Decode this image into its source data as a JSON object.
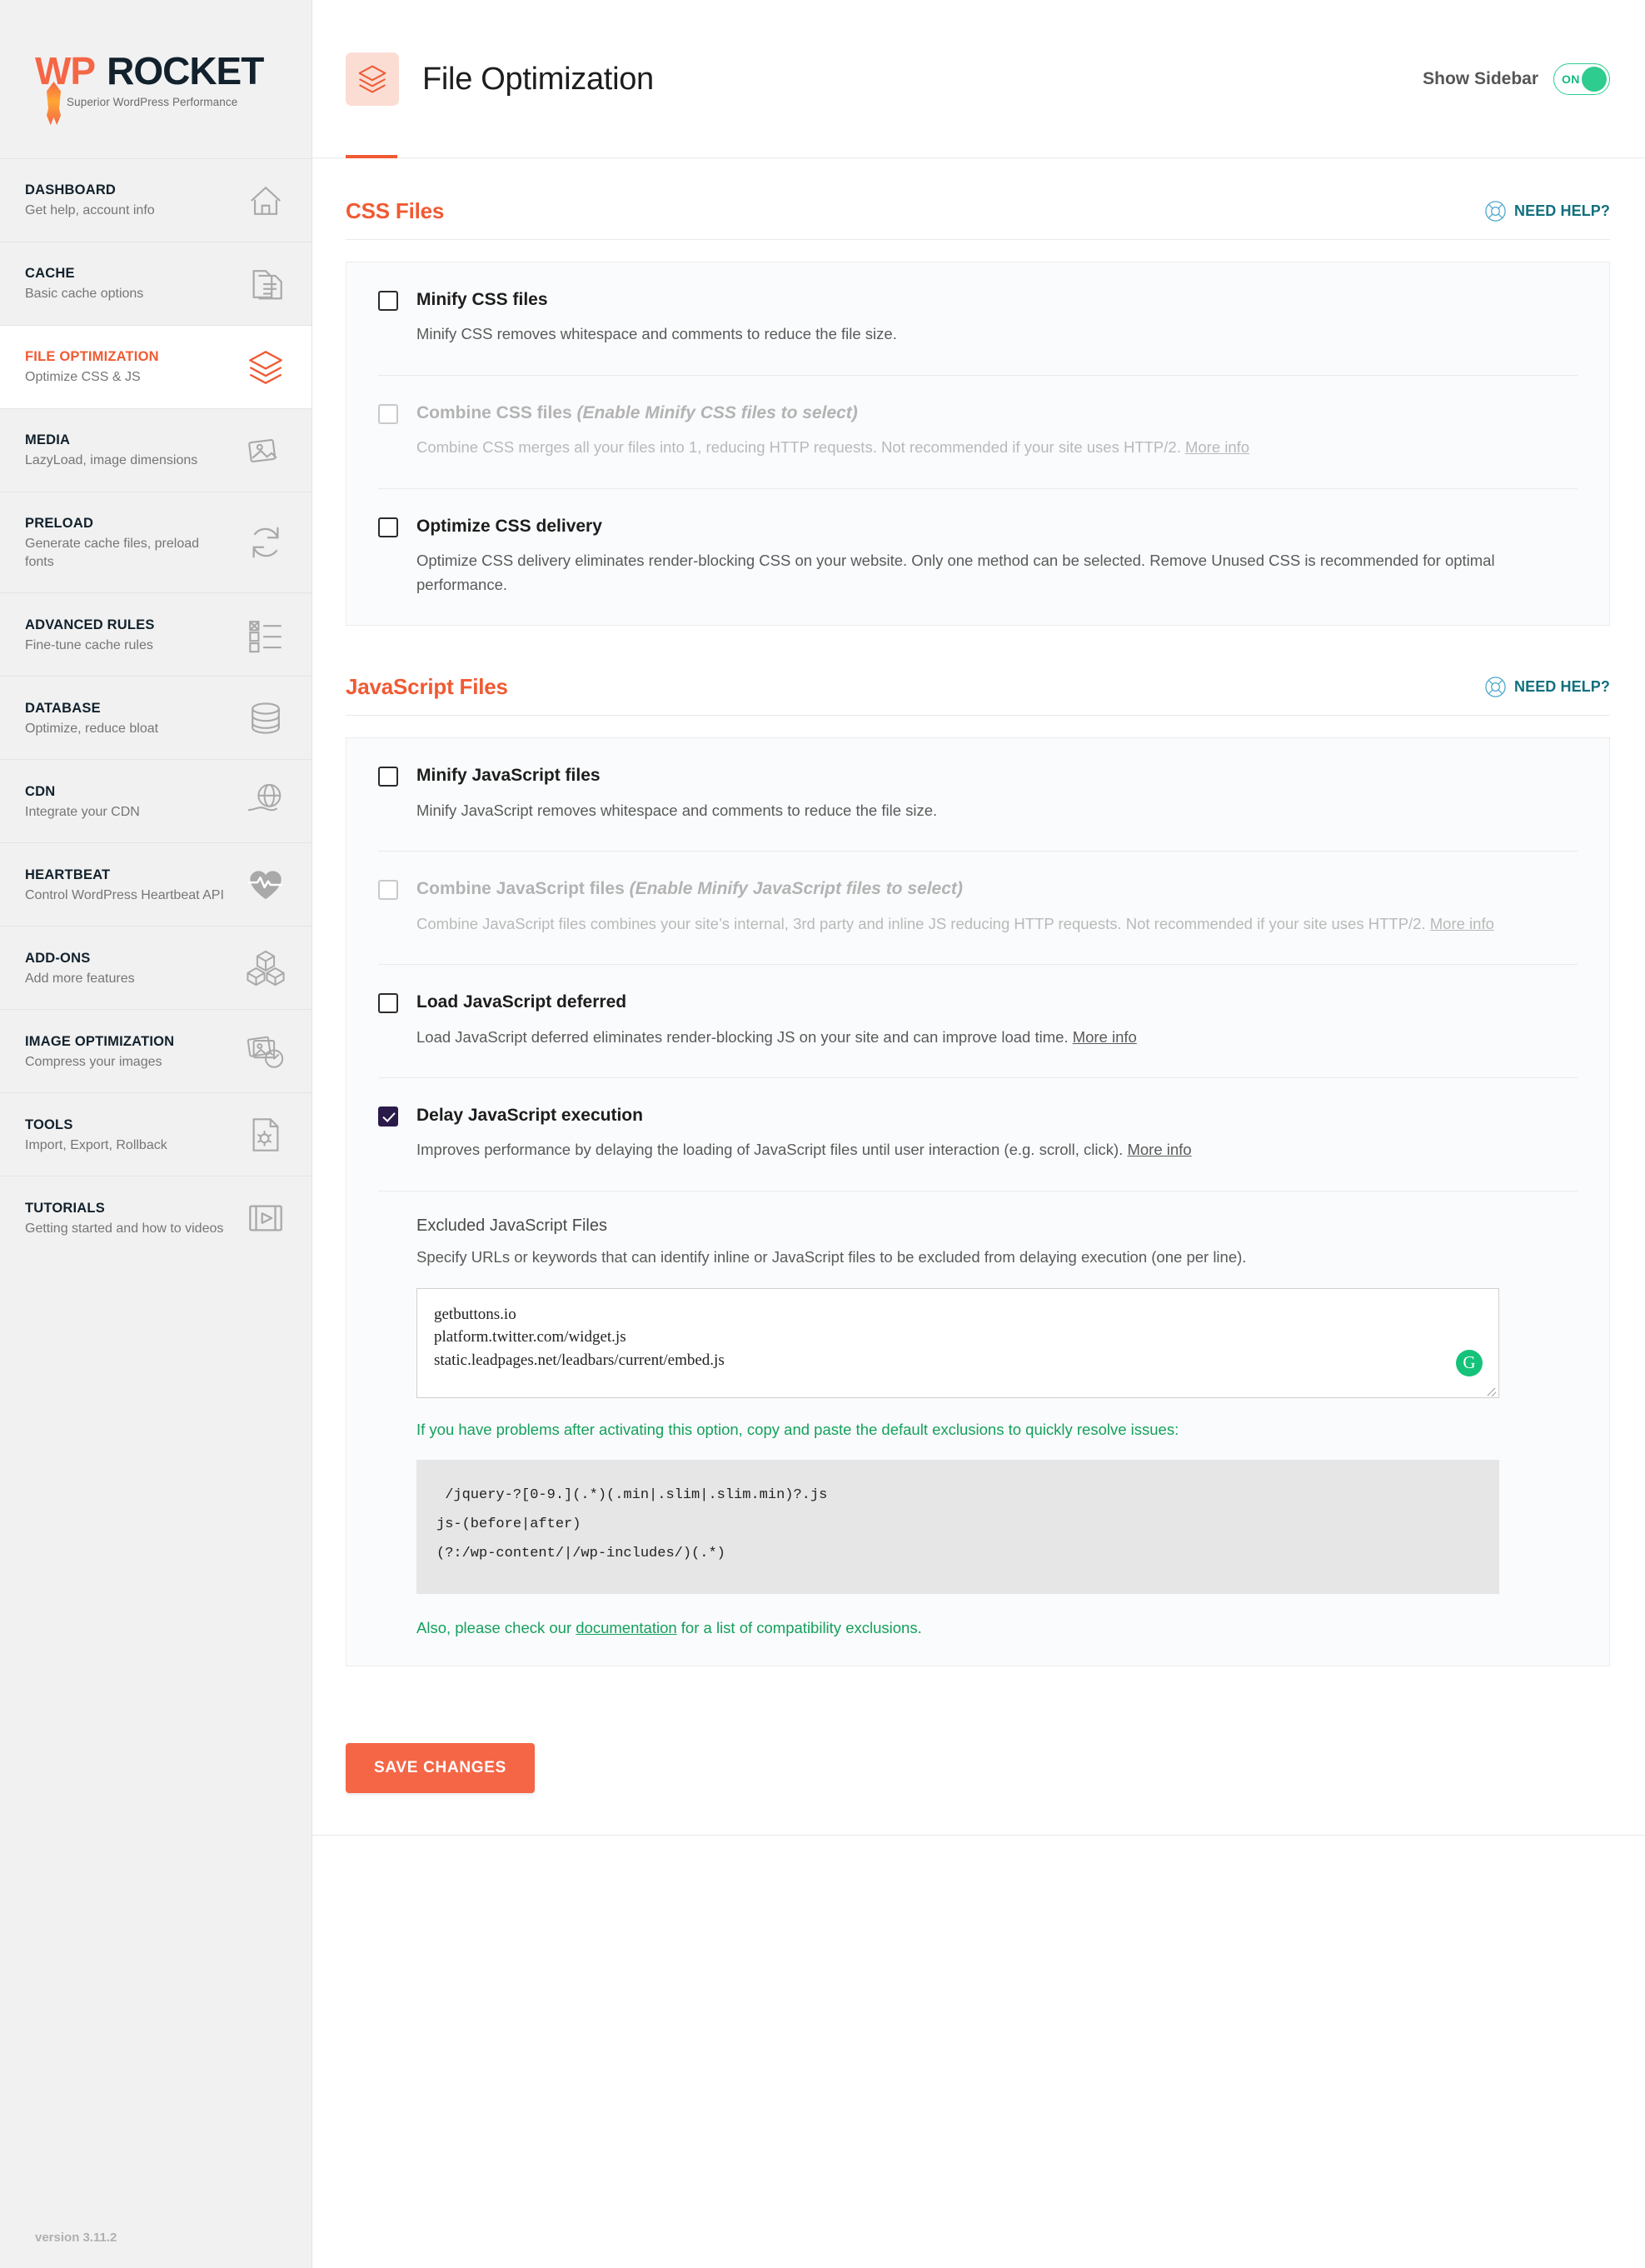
{
  "brand": {
    "wp": "WP",
    "rocket": "ROCKET",
    "tagline": "Superior WordPress Performance",
    "version": "version 3.11.2"
  },
  "sidebar": {
    "items": [
      {
        "title": "DASHBOARD",
        "desc": "Get help, account info",
        "icon": "home-icon",
        "active": false
      },
      {
        "title": "CACHE",
        "desc": "Basic cache options",
        "icon": "document-icon",
        "active": false
      },
      {
        "title": "FILE OPTIMIZATION",
        "desc": "Optimize CSS & JS",
        "icon": "layers-icon",
        "active": true
      },
      {
        "title": "MEDIA",
        "desc": "LazyLoad, image dimensions",
        "icon": "images-icon",
        "active": false
      },
      {
        "title": "PRELOAD",
        "desc": "Generate cache files, preload fonts",
        "icon": "refresh-icon",
        "active": false
      },
      {
        "title": "ADVANCED RULES",
        "desc": "Fine-tune cache rules",
        "icon": "checklist-icon",
        "active": false
      },
      {
        "title": "DATABASE",
        "desc": "Optimize, reduce bloat",
        "icon": "database-icon",
        "active": false
      },
      {
        "title": "CDN",
        "desc": "Integrate your CDN",
        "icon": "cdn-globe-icon",
        "active": false
      },
      {
        "title": "HEARTBEAT",
        "desc": "Control WordPress Heartbeat API",
        "icon": "heartbeat-icon",
        "active": false
      },
      {
        "title": "ADD-ONS",
        "desc": "Add more features",
        "icon": "blocks-icon",
        "active": false
      },
      {
        "title": "IMAGE OPTIMIZATION",
        "desc": "Compress your images",
        "icon": "image-compress-icon",
        "active": false
      },
      {
        "title": "TOOLS",
        "desc": "Import, Export, Rollback",
        "icon": "file-gear-icon",
        "active": false
      },
      {
        "title": "TUTORIALS",
        "desc": "Getting started and how to videos",
        "icon": "video-icon",
        "active": false
      }
    ]
  },
  "header": {
    "title": "File Optimization",
    "icon": "layers-icon",
    "show_sidebar_label": "Show Sidebar",
    "toggle_state": "ON"
  },
  "need_help_label": "NEED HELP?",
  "css_section": {
    "title": "CSS Files",
    "options": [
      {
        "label": "Minify CSS files",
        "hint": "",
        "desc": "Minify CSS removes whitespace and comments to reduce the file size.",
        "link": "",
        "checked": false,
        "disabled": false
      },
      {
        "label": "Combine CSS files ",
        "hint": "(Enable Minify CSS files to select)",
        "desc": "Combine CSS merges all your files into 1, reducing HTTP requests. Not recommended if your site uses HTTP/2. ",
        "link": "More info",
        "checked": false,
        "disabled": true
      },
      {
        "label": "Optimize CSS delivery",
        "hint": "",
        "desc": "Optimize CSS delivery eliminates render-blocking CSS on your website. Only one method can be selected. Remove Unused CSS is recommended for optimal performance.",
        "link": "",
        "checked": false,
        "disabled": false
      }
    ]
  },
  "js_section": {
    "title": "JavaScript Files",
    "options": [
      {
        "label": "Minify JavaScript files",
        "hint": "",
        "desc": "Minify JavaScript removes whitespace and comments to reduce the file size.",
        "link": "",
        "checked": false,
        "disabled": false
      },
      {
        "label": "Combine JavaScript files ",
        "hint": "(Enable Minify JavaScript files to select)",
        "desc": "Combine JavaScript files combines your site’s internal, 3rd party and inline JS reducing HTTP requests. Not recommended if your site uses HTTP/2. ",
        "link": "More info",
        "checked": false,
        "disabled": true
      },
      {
        "label": "Load JavaScript deferred",
        "hint": "",
        "desc": "Load JavaScript deferred eliminates render-blocking JS on your site and can improve load time. ",
        "link": "More info",
        "checked": false,
        "disabled": false
      },
      {
        "label": "Delay JavaScript execution",
        "hint": "",
        "desc": "Improves performance by delaying the loading of JavaScript files until user interaction (e.g. scroll, click). ",
        "link": "More info",
        "checked": true,
        "disabled": false
      }
    ],
    "excluded": {
      "title": "Excluded JavaScript Files",
      "desc": "Specify URLs or keywords that can identify inline or JavaScript files to be excluded from delaying execution (one per line).",
      "textarea_value": "getbuttons.io\nplatform.twitter.com/widget.js\nstatic.leadpages.net/leadbars/current/embed.js",
      "grammarly_badge": "G",
      "green_note": "If you have problems after activating this option, copy and paste the default exclusions to quickly resolve issues:",
      "code_lines": [
        " /jquery-?[0-9.](.*)(.min|.slim|.slim.min)?.js",
        "js-(before|after)",
        "(?:/wp-content/|/wp-includes/)(.*)"
      ],
      "doc_note_before": "Also, please check our ",
      "doc_note_link": "documentation",
      "doc_note_after": " for a list of compatibility exclusions."
    }
  },
  "save_label": "SAVE CHANGES",
  "colors": {
    "accent": "#f05a33",
    "brand_orange": "#f56646",
    "toggle_green": "#2ecc8f",
    "need_help_teal": "#10707d",
    "note_green": "#14a05c",
    "checkbox_checked": "#2a1a4a"
  }
}
